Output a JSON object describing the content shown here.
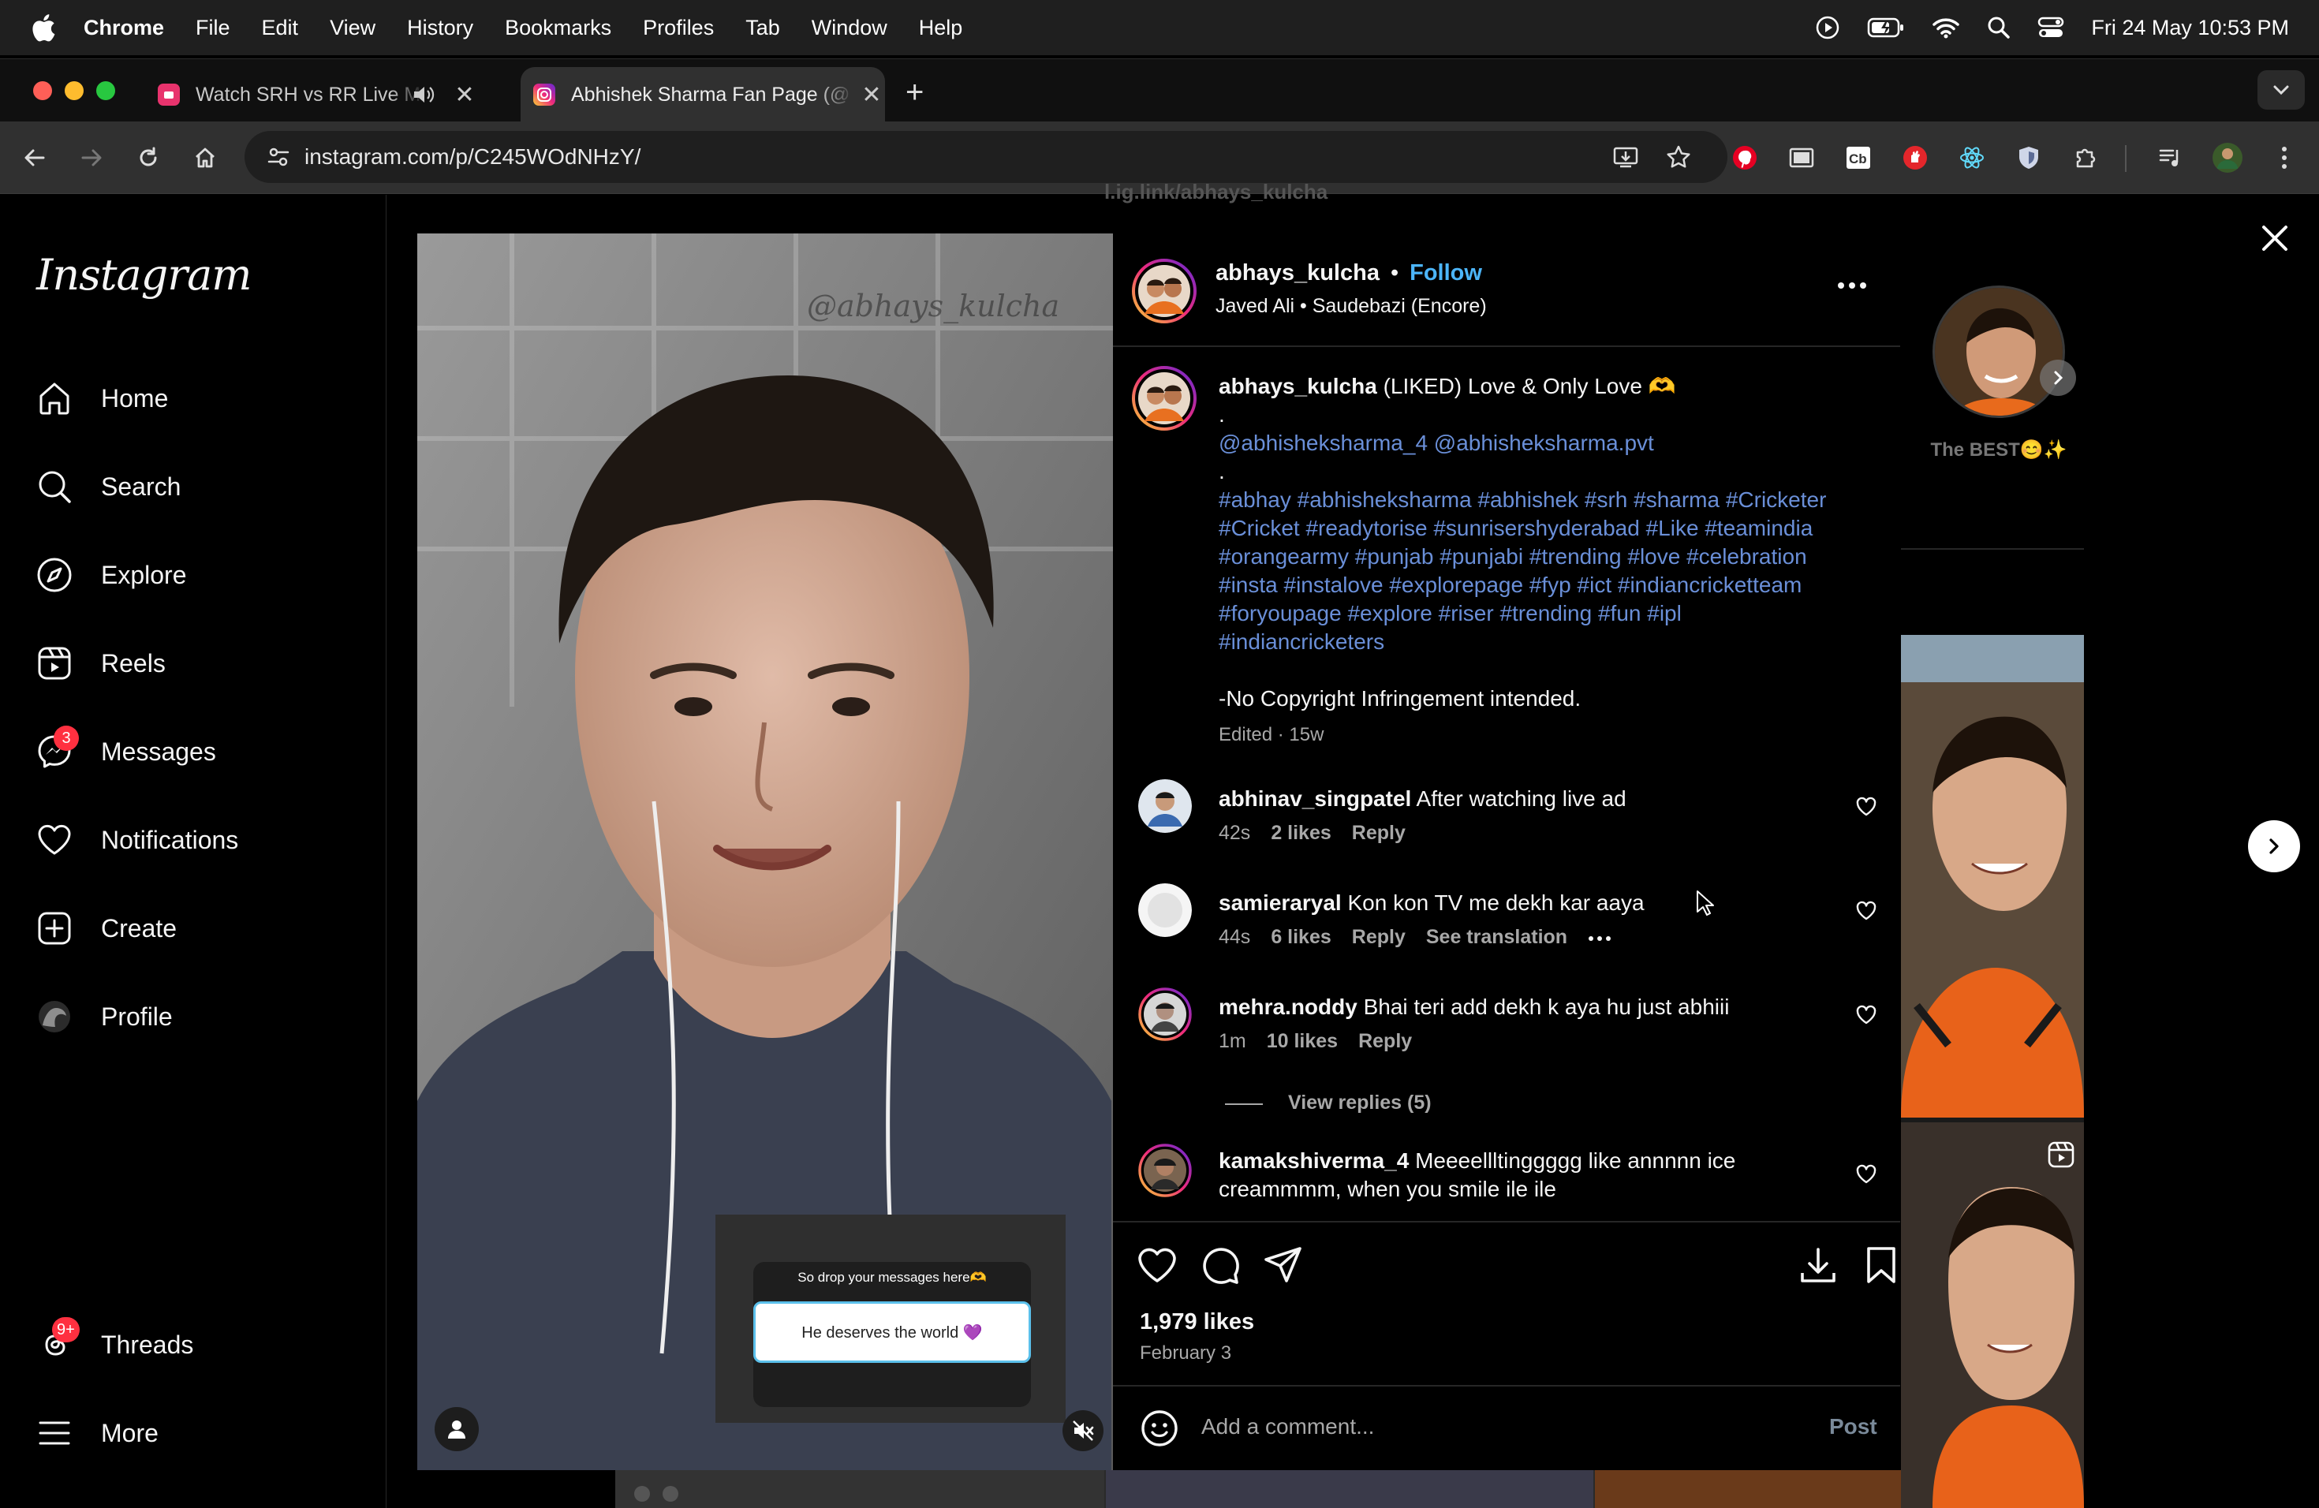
{
  "menubar": {
    "items": [
      "Chrome",
      "File",
      "Edit",
      "View",
      "History",
      "Bookmarks",
      "Profiles",
      "Tab",
      "Window",
      "Help"
    ],
    "datetime": "Fri 24 May  10:53 PM"
  },
  "tabs": [
    {
      "title": "Watch SRH vs RR Live Ma",
      "favicon_color": "#e8336d"
    },
    {
      "title": "Abhishek Sharma Fan Page (@",
      "favicon_color": "#d6249f"
    }
  ],
  "omnibox": {
    "url": "instagram.com/p/C245WOdNHzY/"
  },
  "sidebar": {
    "logo": "Instagram",
    "items": [
      {
        "label": "Home",
        "icon": "home-icon"
      },
      {
        "label": "Search",
        "icon": "search-icon"
      },
      {
        "label": "Explore",
        "icon": "explore-icon"
      },
      {
        "label": "Reels",
        "icon": "reels-icon"
      },
      {
        "label": "Messages",
        "icon": "messages-icon",
        "badge": "3"
      },
      {
        "label": "Notifications",
        "icon": "heart-icon"
      },
      {
        "label": "Create",
        "icon": "create-icon"
      },
      {
        "label": "Profile",
        "icon": "profile-icon"
      }
    ],
    "threads": {
      "label": "Threads",
      "badge": "9+"
    },
    "more": {
      "label": "More"
    }
  },
  "top_partial_text": "l.ig.link/abhays_kulcha",
  "side_story": {
    "label": "The BEST😊✨"
  },
  "media": {
    "watermark": "@abhays_kulcha",
    "question_title": "So drop your messages here🫶",
    "question_answer": "He deserves the world 💜"
  },
  "post": {
    "username": "abhays_kulcha",
    "follow": "Follow",
    "audio": "Javed Ali • Saudebazi (Encore)",
    "caption": {
      "text": "(LIKED) Love & Only Love 🫶",
      "dot1": ".",
      "mentions": "@abhisheksharma_4 @abhisheksharma.pvt",
      "dot2": ".",
      "hashtag_lines": [
        "#abhay #abhisheksharma #abhishek #srh #sharma #Cricketer",
        "#Cricket #readytorise #sunrisershyderabad #Like #teamindia",
        "#orangearmy #punjab #punjabi #trending #love #celebration",
        "#insta #instalove #explorepage #fyp #ict #indiancricketteam",
        "#foryoupage #explore #riser #trending #fun #ipl",
        "#indiancricketers"
      ],
      "disclaimer": "-No Copyright Infringement intended.",
      "edited": "Edited · 15w"
    },
    "comments": [
      {
        "user": "abhinav_singpatel",
        "text": "After watching live ad",
        "time": "42s",
        "likes": "2 likes",
        "reply": "Reply"
      },
      {
        "user": "samieraryal",
        "text": "Kon kon TV me dekh kar aaya",
        "time": "44s",
        "likes": "6 likes",
        "reply": "Reply",
        "translate": "See translation"
      },
      {
        "user": "mehra.noddy",
        "text": "Bhai teri add dekh k aya hu just abhiii",
        "time": "1m",
        "likes": "10 likes",
        "reply": "Reply"
      },
      {
        "user": "kamakshiverma_4",
        "text": "Meeeellltinggggg like annnnn ice",
        "text2": "creammmm, when you smile ile ile"
      }
    ],
    "view_replies": "View replies (5)",
    "likes": "1,979 likes",
    "date": "February 3",
    "add_comment_placeholder": "Add a comment...",
    "post_button": "Post"
  },
  "colors": {
    "link": "#6a8fd8",
    "follow": "#e0f1ff",
    "badge": "#ff3040"
  }
}
